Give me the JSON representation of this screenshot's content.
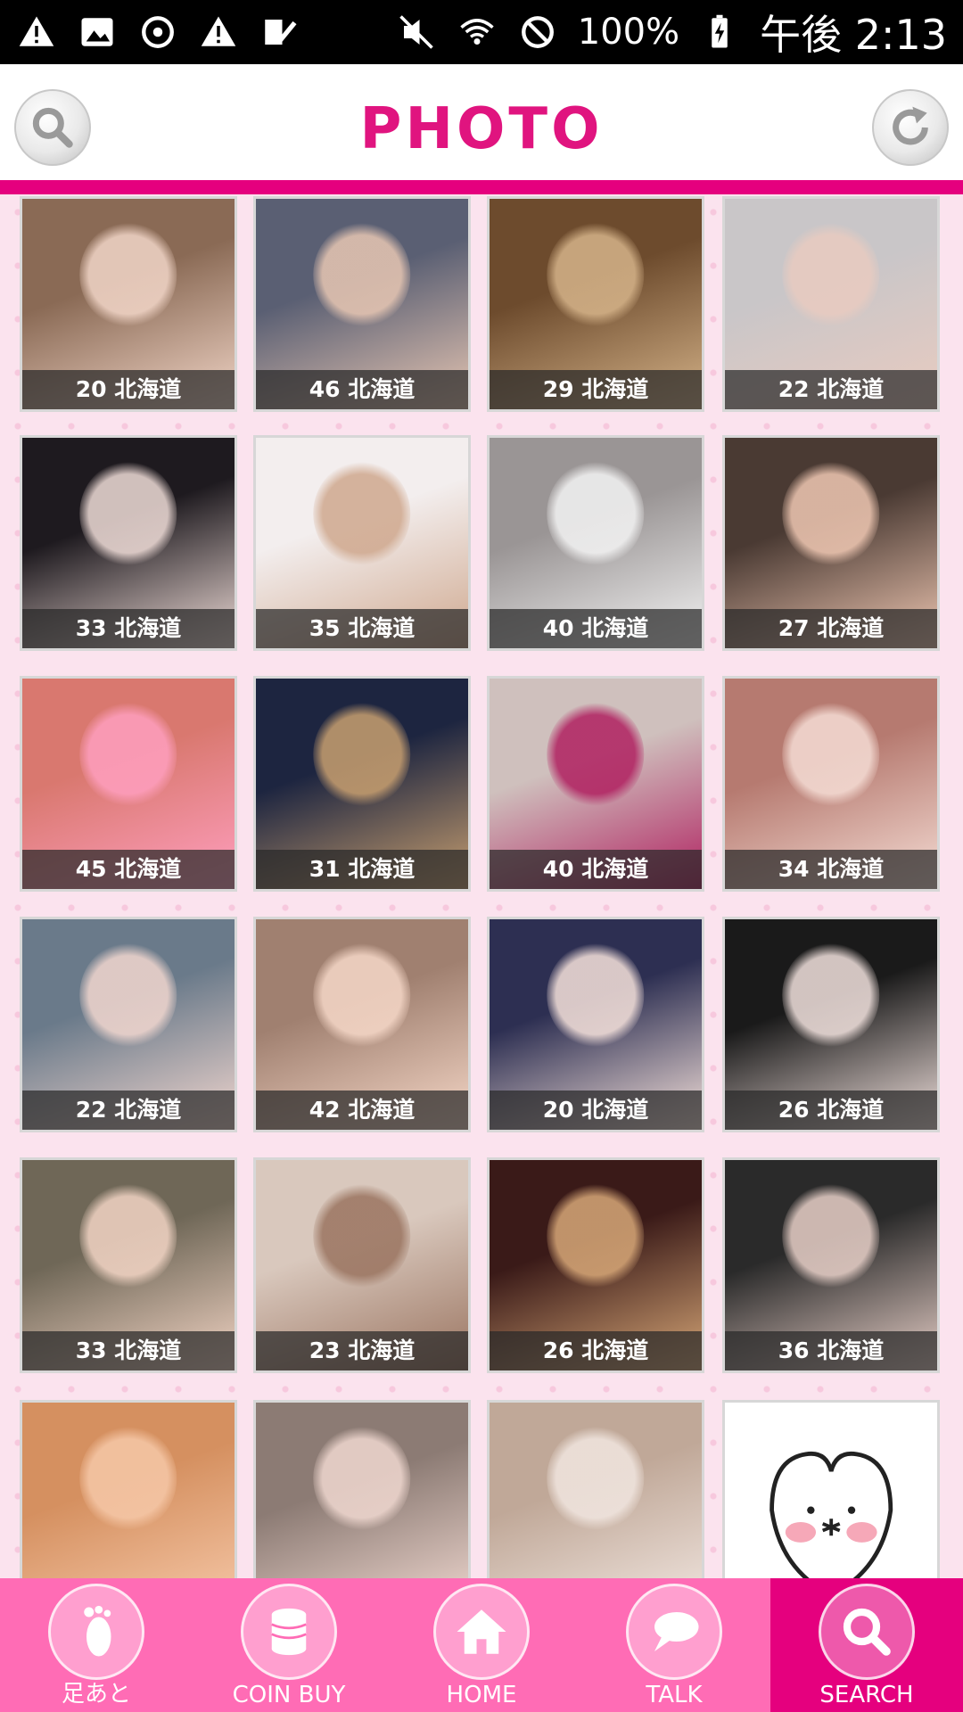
{
  "status_bar": {
    "battery": "100%",
    "time": "午後 2:13",
    "left_icons": [
      "warning-icon",
      "image-icon",
      "sync-icon",
      "warning-icon",
      "check-icon"
    ],
    "right_icons": [
      "mute-icon",
      "wifi-icon",
      "do-not-disturb-icon",
      "battery-icon"
    ]
  },
  "header": {
    "title": "PHOTO",
    "left_button": "search-icon",
    "right_button": "refresh-icon"
  },
  "photos": [
    {
      "label": "20 北海道",
      "colors": [
        "#8a6a55",
        "#f2d6c8"
      ]
    },
    {
      "label": "46 北海道",
      "colors": [
        "#5a5f73",
        "#e8c7b3"
      ]
    },
    {
      "label": "29 北海道",
      "colors": [
        "#6d4b2d",
        "#d6b48a"
      ]
    },
    {
      "label": "22 北海道",
      "colors": [
        "#c9c6c8",
        "#e9cbc0"
      ]
    },
    {
      "label": "33 北海道",
      "colors": [
        "#1e1a1f",
        "#f0ddd8"
      ]
    },
    {
      "label": "35 北海道",
      "colors": [
        "#f3eeee",
        "#cfa88e"
      ]
    },
    {
      "label": "40 北海道",
      "colors": [
        "#9a9595",
        "#f4f4f4"
      ]
    },
    {
      "label": "27 北海道",
      "colors": [
        "#4a3a33",
        "#f0c8b3"
      ]
    },
    {
      "label": "45 北海道",
      "colors": [
        "#d9786f",
        "#ff9fbf"
      ]
    },
    {
      "label": "31 北海道",
      "colors": [
        "#1d2540",
        "#c9a070"
      ]
    },
    {
      "label": "40 北海道",
      "colors": [
        "#cfc0bd",
        "#b02060"
      ]
    },
    {
      "label": "34 北海道",
      "colors": [
        "#b67a70",
        "#f5ddd5"
      ]
    },
    {
      "label": "22 北海道",
      "colors": [
        "#6a7a8a",
        "#f2d7cf"
      ]
    },
    {
      "label": "42 北海道",
      "colors": [
        "#a08070",
        "#f6d8c8"
      ]
    },
    {
      "label": "20 北海道",
      "colors": [
        "#2d2f52",
        "#f7e3dc"
      ]
    },
    {
      "label": "26 北海道",
      "colors": [
        "#1a1a1a",
        "#f2e2de"
      ]
    },
    {
      "label": "33 北海道",
      "colors": [
        "#6f6757",
        "#f3d5c5"
      ]
    },
    {
      "label": "23 北海道",
      "colors": [
        "#d9c8bd",
        "#9a7460"
      ]
    },
    {
      "label": "26 北海道",
      "colors": [
        "#3a1a18",
        "#d8a878"
      ]
    },
    {
      "label": "36 北海道",
      "colors": [
        "#2a2a2a",
        "#e8d0c8"
      ]
    },
    {
      "label": "",
      "colors": [
        "#d59060",
        "#f6c8a8"
      ]
    },
    {
      "label": "",
      "colors": [
        "#8c7b74",
        "#f0d8d0"
      ]
    },
    {
      "label": "",
      "colors": [
        "#c0a898",
        "#f1e6e0"
      ]
    },
    {
      "label": "",
      "colors": [
        "#ffffff",
        "#ffffff"
      ],
      "sticker": true
    }
  ],
  "tabbar": {
    "tabs": [
      {
        "label": "足あと",
        "icon": "footprint-icon",
        "active": false
      },
      {
        "label": "COIN BUY",
        "icon": "coins-icon",
        "active": false
      },
      {
        "label": "HOME",
        "icon": "home-icon",
        "active": false
      },
      {
        "label": "TALK",
        "icon": "chat-bubble-icon",
        "active": false
      },
      {
        "label": "SEARCH",
        "icon": "search-icon",
        "active": true
      }
    ]
  },
  "theme": {
    "accent": "#e5007e",
    "tab_bg": "#ff6cb5",
    "page_bg": "#fbe3ee"
  }
}
